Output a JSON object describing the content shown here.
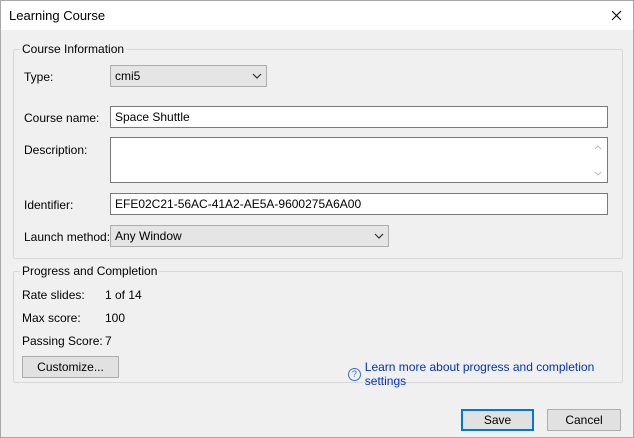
{
  "window": {
    "title": "Learning Course"
  },
  "course_info": {
    "legend": "Course Information",
    "type_label": "Type:",
    "type_value": "cmi5",
    "course_name_label": "Course name:",
    "course_name_value": "Space Shuttle",
    "description_label": "Description:",
    "description_value": "",
    "identifier_label": "Identifier:",
    "identifier_value": "EFE02C21-56AC-41A2-AE5A-9600275A6A00",
    "launch_method_label": "Launch method:",
    "launch_method_value": "Any Window"
  },
  "progress": {
    "legend": "Progress and Completion",
    "rate_slides_label": "Rate slides:",
    "rate_slides_value": "1 of 14",
    "max_score_label": "Max score:",
    "max_score_value": "100",
    "passing_score_label": "Passing Score:",
    "passing_score_value": "7",
    "customize_label": "Customize...",
    "learn_more_label": "Learn more about progress and completion settings"
  },
  "footer": {
    "save_label": "Save",
    "cancel_label": "Cancel"
  },
  "icons": {
    "close": "close-icon",
    "dropdown": "chevron-down-icon",
    "help": "question-circle-icon",
    "scroll_up": "scroll-up-arrow-icon",
    "scroll_down": "scroll-down-arrow-icon"
  },
  "colors": {
    "accent": "#0078d7",
    "link": "#0033bb"
  }
}
